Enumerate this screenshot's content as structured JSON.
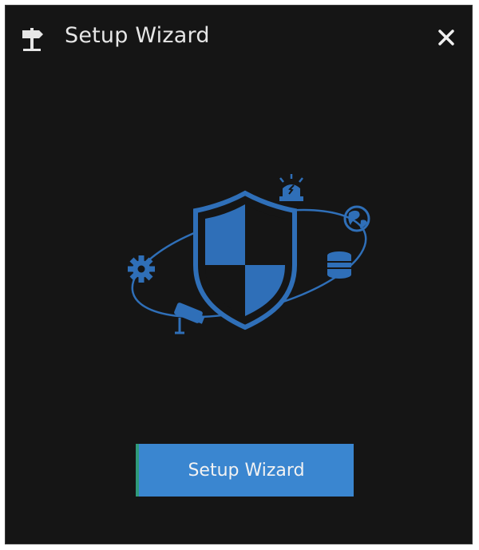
{
  "dialog": {
    "title": "Setup Wizard",
    "title_icon": "signpost-icon",
    "close_icon": "close-icon"
  },
  "illustration": {
    "icons": [
      "shield-icon",
      "gear-icon",
      "alarm-light-icon",
      "globe-icon",
      "database-icon",
      "camera-icon"
    ]
  },
  "actions": {
    "setup_wizard_label": "Setup Wizard"
  },
  "colors": {
    "background": "#151515",
    "accent": "#3a86d0",
    "icon_blue": "#2f6fb8",
    "title_text": "#e6e6e6"
  }
}
